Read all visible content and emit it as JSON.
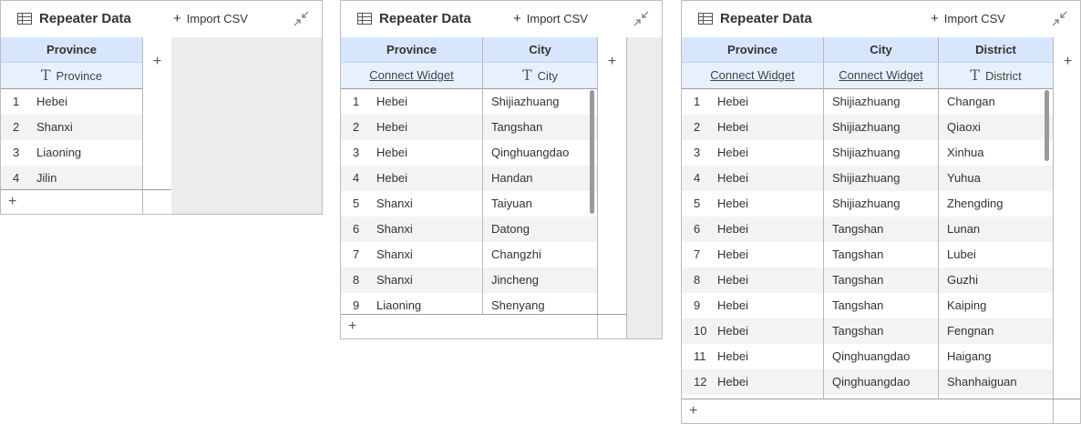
{
  "panels": [
    {
      "title": "Repeater Data",
      "import_label": "Import CSV",
      "columns": [
        {
          "name": "Province",
          "sub": "Province",
          "sub_type": "text"
        }
      ],
      "rows": [
        [
          "1",
          "Hebei"
        ],
        [
          "2",
          "Shanxi"
        ],
        [
          "3",
          "Liaoning"
        ],
        [
          "4",
          "Jilin"
        ]
      ]
    },
    {
      "title": "Repeater Data",
      "import_label": "Import CSV",
      "columns": [
        {
          "name": "Province",
          "sub": "Connect Widget",
          "sub_type": "link"
        },
        {
          "name": "City",
          "sub": "City",
          "sub_type": "text"
        }
      ],
      "rows": [
        [
          "1",
          "Hebei",
          "Shijiazhuang"
        ],
        [
          "2",
          "Hebei",
          "Tangshan"
        ],
        [
          "3",
          "Hebei",
          "Qinghuangdao"
        ],
        [
          "4",
          "Hebei",
          "Handan"
        ],
        [
          "5",
          "Shanxi",
          "Taiyuan"
        ],
        [
          "6",
          "Shanxi",
          "Datong"
        ],
        [
          "7",
          "Shanxi",
          "Changzhi"
        ],
        [
          "8",
          "Shanxi",
          "Jincheng"
        ],
        [
          "9",
          "Liaoning",
          "Shenyang"
        ]
      ]
    },
    {
      "title": "Repeater Data",
      "import_label": "Import CSV",
      "columns": [
        {
          "name": "Province",
          "sub": "Connect Widget",
          "sub_type": "link"
        },
        {
          "name": "City",
          "sub": "Connect Widget",
          "sub_type": "link"
        },
        {
          "name": "District",
          "sub": "District",
          "sub_type": "text"
        }
      ],
      "rows": [
        [
          "1",
          "Hebei",
          "Shijiazhuang",
          "Changan"
        ],
        [
          "2",
          "Hebei",
          "Shijiazhuang",
          "Qiaoxi"
        ],
        [
          "3",
          "Hebei",
          "Shijiazhuang",
          "Xinhua"
        ],
        [
          "4",
          "Hebei",
          "Shijiazhuang",
          "Yuhua"
        ],
        [
          "5",
          "Hebei",
          "Shijiazhuang",
          "Zhengding"
        ],
        [
          "6",
          "Hebei",
          "Tangshan",
          "Lunan"
        ],
        [
          "7",
          "Hebei",
          "Tangshan",
          "Lubei"
        ],
        [
          "8",
          "Hebei",
          "Tangshan",
          "Guzhi"
        ],
        [
          "9",
          "Hebei",
          "Tangshan",
          "Kaiping"
        ],
        [
          "10",
          "Hebei",
          "Tangshan",
          "Fengnan"
        ],
        [
          "11",
          "Hebei",
          "Qinghuangdao",
          "Haigang"
        ],
        [
          "12",
          "Hebei",
          "Qinghuangdao",
          "Shanhaiguan"
        ]
      ]
    }
  ],
  "icons": {
    "table": "table-icon",
    "collapse": "collapse-icon",
    "add": "plus-icon",
    "text_type": "text-type-icon"
  },
  "colors": {
    "header_bg": "#d7e6fc",
    "subheader_bg": "#e8f0fe",
    "alt_row_bg": "#f3f3f3",
    "canvas_gray": "#ececec"
  }
}
